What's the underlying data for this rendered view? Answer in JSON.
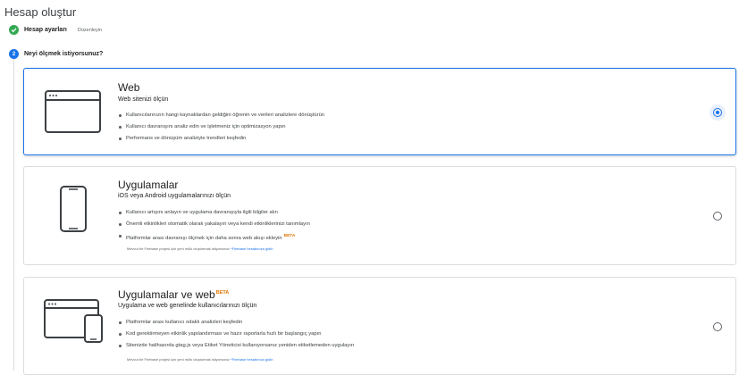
{
  "page": {
    "title": "Hesap oluştur"
  },
  "steps": [
    {
      "label": "Hesap ayarları",
      "edit_label": "Düzenleyin",
      "status": "done",
      "icon": "check-icon"
    },
    {
      "label": "Neyi ölçmek istiyorsunuz?",
      "number": "2",
      "status": "active"
    }
  ],
  "colors": {
    "accent": "#1a73e8",
    "done": "#34a853",
    "beta": "#e37400"
  },
  "options": [
    {
      "title": "Web",
      "subtitle": "Web sitenizi ölçün",
      "icon": "browser-window-icon",
      "selected": true,
      "bullets": [
        "Kullanıcılarınızın hangi kaynaklardan geldiğini öğrenin ve verileri analizlere dönüştürün",
        "Kullanıcı davranışını analiz edin ve işletmeniz için optimizasyon yapın",
        "Performans ve dönüşüm analiziyle trendleri keşfedin"
      ]
    },
    {
      "title": "Uygulamalar",
      "subtitle": "iOS veya Android uygulamalarınızı ölçün",
      "icon": "mobile-phone-icon",
      "selected": false,
      "bullets": [
        "Kullanıcı artışını anlayın ve uygulama davranışıyla ilgili bilgiler alın",
        "Önemli etkinlikleri otomatik olarak yakalayın veya kendi etkinliklerinizi tanımlayın",
        "Platformlar arası davranışı ölçmek için daha sonra web akışı ekleyin"
      ],
      "beta": "BETA",
      "fine_text": "Mevcut bir Firebase projesi için yeni mülk oluşturmak istiyorsanız",
      "fine_link": "*Firebase hesabınıza gidin"
    },
    {
      "title": "Uygulamalar ve web",
      "title_badge": "BETA",
      "subtitle": "Uygulama ve web genelinde kullanıcılarınızı ölçün",
      "icon": "browser-and-phone-icon",
      "selected": false,
      "bullets": [
        "Platformlar arası kullanıcı odaklı analizleri keşfedin",
        "Kod gerektirmeyen etkinlik yapılandırması ve hazır raporlarla hızlı bir başlangıç yapın",
        "Sitenizde halihazırda gtag.js veya Etiket Yöneticisi kullanıyorsanız yeniden etiketlemeden uygulayın"
      ],
      "fine_text": "Mevcut bir Firebase projesi için yeni mülk oluşturmak istiyorsanız",
      "fine_link": "*Firebase hesabınıza gidin"
    }
  ]
}
